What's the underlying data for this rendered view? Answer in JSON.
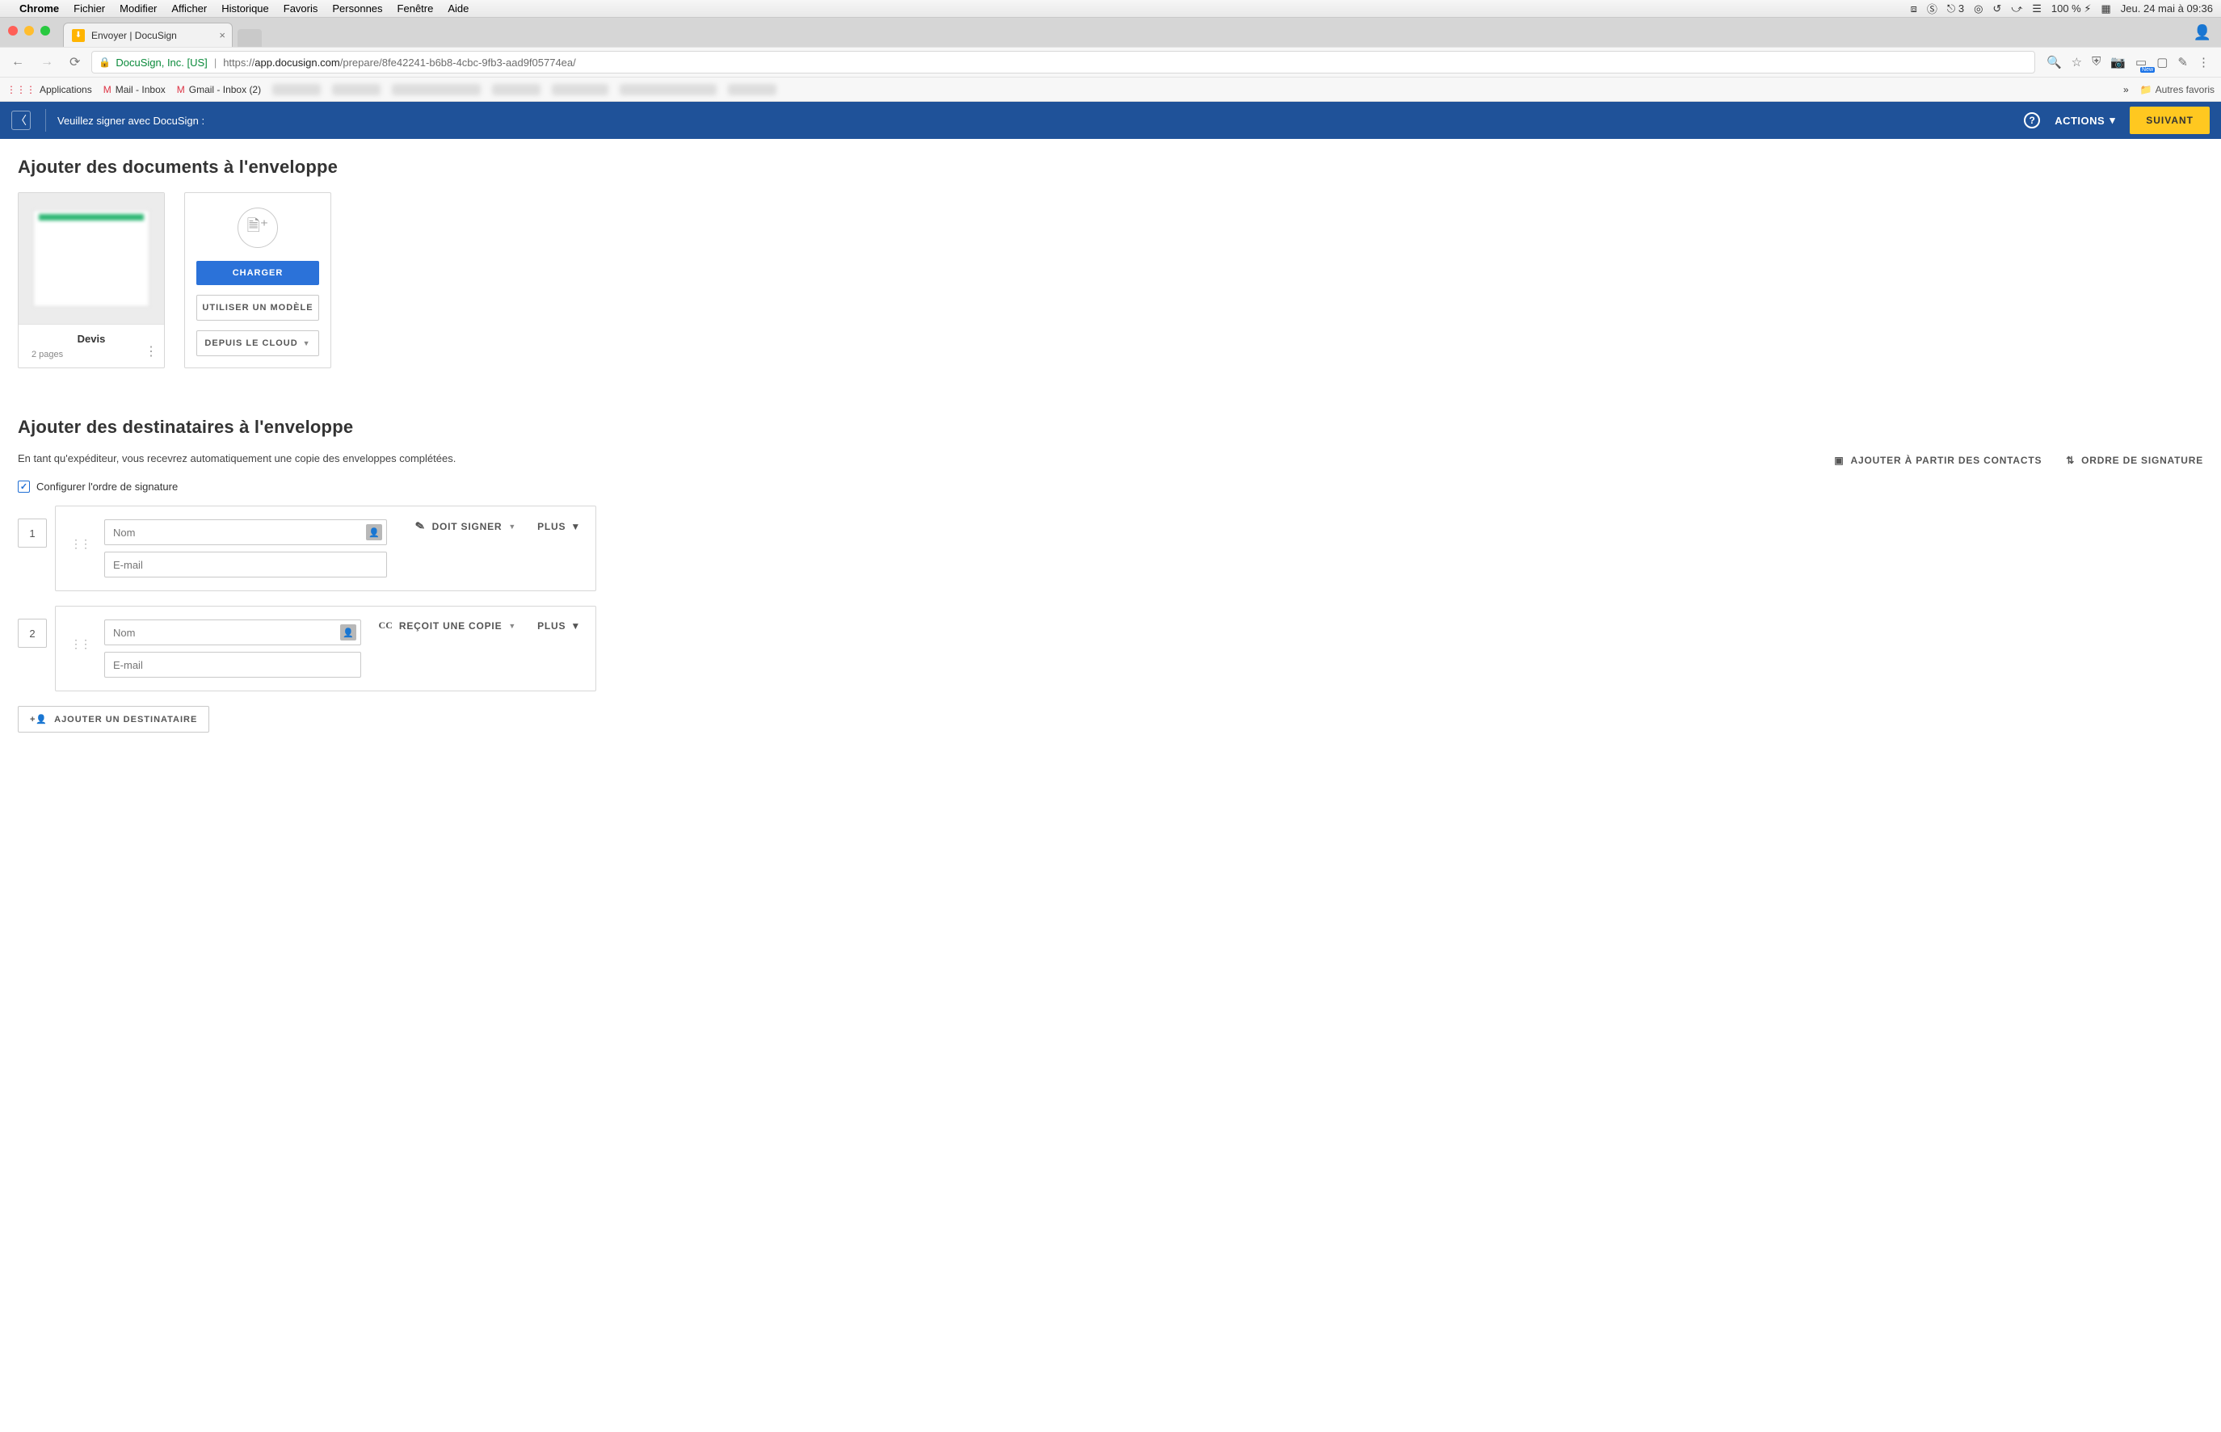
{
  "mac": {
    "app": "Chrome",
    "menus": [
      "Fichier",
      "Modifier",
      "Afficher",
      "Historique",
      "Favoris",
      "Personnes",
      "Fenêtre",
      "Aide"
    ],
    "ai_badge": "3",
    "battery": "100 %",
    "datetime": "Jeu. 24 mai à  09:36"
  },
  "browser": {
    "tab_title": "Envoyer | DocuSign",
    "ev_label": "DocuSign, Inc. [US]",
    "url_prefix": "https://",
    "url_host": "app.docusign.com",
    "url_path": "/prepare/8fe42241-b6b8-4cbc-9fb3-aad9f05774ea/",
    "bookmarks": {
      "apps": "Applications",
      "mail": "Mail - Inbox",
      "gmail": "Gmail - Inbox (2)",
      "autres": "Autres favoris"
    }
  },
  "ds": {
    "header_title": "Veuillez signer avec DocuSign :",
    "actions_label": "ACTIONS",
    "next_label": "SUIVANT"
  },
  "docs": {
    "section_title": "Ajouter des documents à l'enveloppe",
    "card": {
      "name": "Devis",
      "pages": "2 pages"
    },
    "upload": "CHARGER",
    "use_template": "UTILISER UN MODÈLE",
    "from_cloud": "DEPUIS LE CLOUD"
  },
  "recip": {
    "section_title": "Ajouter des destinataires à l'enveloppe",
    "subtitle": "En tant qu'expéditeur, vous recevrez automatiquement une copie des enveloppes complétées.",
    "add_from_contacts": "AJOUTER À PARTIR DES CONTACTS",
    "signing_order": "ORDRE DE SIGNATURE",
    "config_order": "Configurer l'ordre de signature",
    "name_ph": "Nom",
    "email_ph": "E-mail",
    "must_sign": "DOIT SIGNER",
    "gets_copy": "REÇOIT UNE COPIE",
    "more": "PLUS",
    "order1": "1",
    "order2": "2",
    "add_recipient": "AJOUTER UN DESTINATAIRE"
  }
}
